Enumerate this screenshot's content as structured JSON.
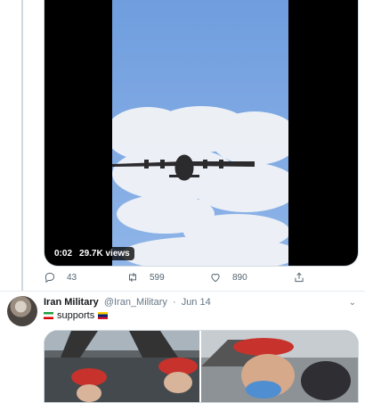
{
  "tweet1": {
    "video": {
      "duration": "0:02",
      "views": "29.7K views"
    },
    "actions": {
      "replies": "43",
      "retweets": "599",
      "likes": "890"
    }
  },
  "tweet2": {
    "name": "Iran Military",
    "handle": "@Iran_Military",
    "separator": "·",
    "date": "Jun 14",
    "text": "supports",
    "flags": [
      "iran-flag",
      "venezuela-flag"
    ]
  },
  "colors": {
    "border": "#cfd9de",
    "muted": "#536471",
    "sky": "#7aa6df"
  }
}
